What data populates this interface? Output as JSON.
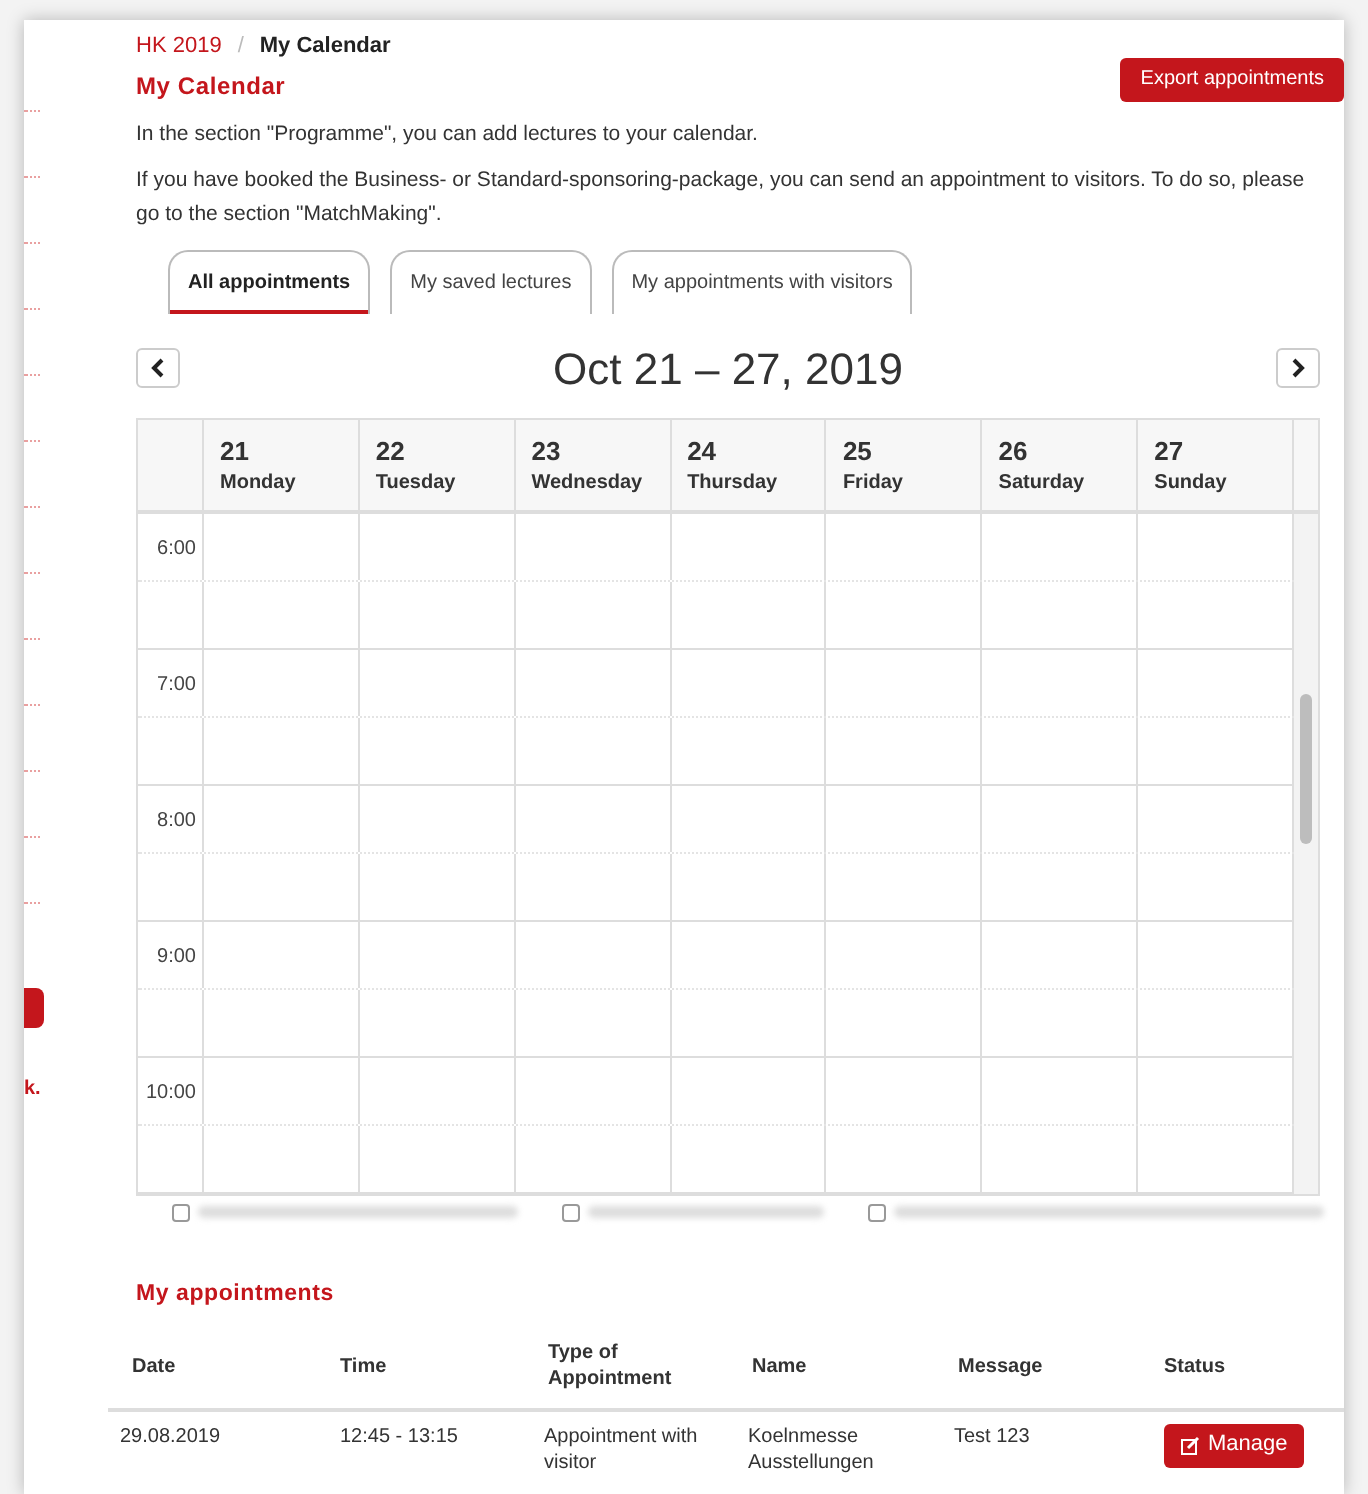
{
  "sidebar": {
    "link_fragment": "k."
  },
  "breadcrumb": [
    {
      "label": "HK 2019",
      "kind": "link"
    },
    {
      "label": "My Calendar",
      "kind": "current"
    }
  ],
  "breadcrumb_separator": "/",
  "title": "My Calendar",
  "export_button": "Export appointments",
  "paragraphs": [
    "In the section \"Programme\", you can add lectures to your calendar.",
    "If you have booked the Business- or Standard-sponsoring-package, you can send an appointment to visitors. To do so, please go to the section \"MatchMaking\"."
  ],
  "tabs": [
    {
      "label": "All appointments",
      "selected": true
    },
    {
      "label": "My saved lectures",
      "selected": false
    },
    {
      "label": "My appointments with visitors",
      "selected": false
    }
  ],
  "calendar": {
    "range": "Oct 21 – 27, 2019",
    "days": [
      {
        "date": "21",
        "weekday": "Monday"
      },
      {
        "date": "22",
        "weekday": "Tuesday"
      },
      {
        "date": "23",
        "weekday": "Wednesday"
      },
      {
        "date": "24",
        "weekday": "Thursday"
      },
      {
        "date": "25",
        "weekday": "Friday"
      },
      {
        "date": "26",
        "weekday": "Saturday"
      },
      {
        "date": "27",
        "weekday": "Sunday"
      }
    ],
    "hours": [
      "6:00",
      "7:00",
      "8:00",
      "9:00",
      "10:00"
    ]
  },
  "visitor_filters": [
    {
      "checked": false
    },
    {
      "checked": false
    },
    {
      "checked": false
    }
  ],
  "appointments": {
    "title": "My appointments",
    "columns": [
      "Date",
      "Time",
      "Type of Appointment",
      "Name",
      "Message",
      "Status"
    ],
    "rows": [
      {
        "date": "29.08.2019",
        "time": "12:45 - 13:15",
        "type": "Appointment with visitor",
        "name": "Koelnmesse Ausstellungen",
        "message": "Test 123",
        "action": "Manage"
      }
    ]
  }
}
